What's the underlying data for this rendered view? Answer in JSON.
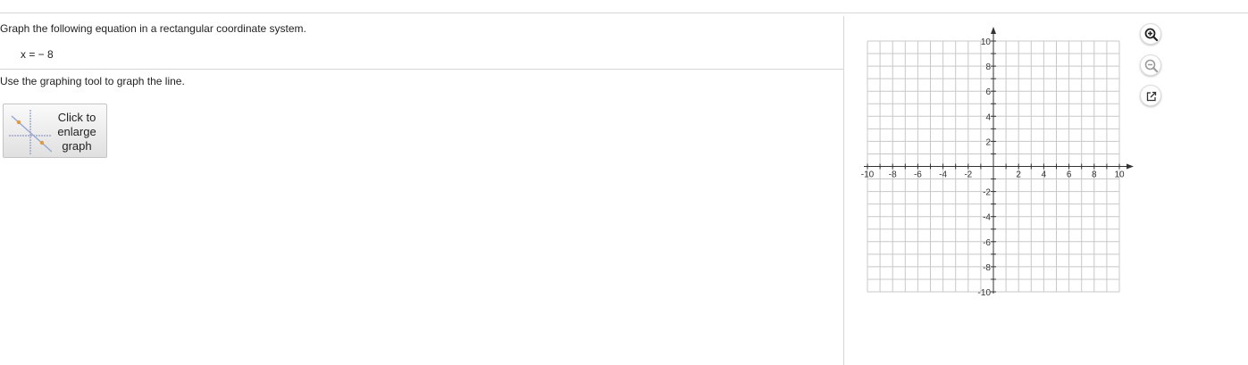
{
  "question": {
    "instruction": "Graph the following equation in a rectangular coordinate system.",
    "equation": "x = − 8",
    "tool_instruction": "Use the graphing tool to graph the line."
  },
  "enlarge_button": {
    "label_line1": "Click to",
    "label_line2": "enlarge",
    "label_line3": "graph"
  },
  "graph": {
    "x_range": [
      -10,
      10
    ],
    "y_range": [
      -10,
      10
    ],
    "grid_step": 1,
    "label_step": 2,
    "x_tick_labels": [
      "-10",
      "-8",
      "-6",
      "-4",
      "-2",
      "2",
      "4",
      "6",
      "8",
      "10"
    ],
    "y_tick_labels": [
      "10",
      "8",
      "6",
      "4",
      "2",
      "-2",
      "-4",
      "-6",
      "-8",
      "-10"
    ],
    "grid_color": "#c8c8c8",
    "axis_color": "#333333"
  },
  "controls": {
    "zoom_in": "zoom-in-icon",
    "zoom_out": "zoom-out-icon",
    "popout": "external-link-icon",
    "active_color": "#222222",
    "disabled_color": "#9a9a9a"
  }
}
